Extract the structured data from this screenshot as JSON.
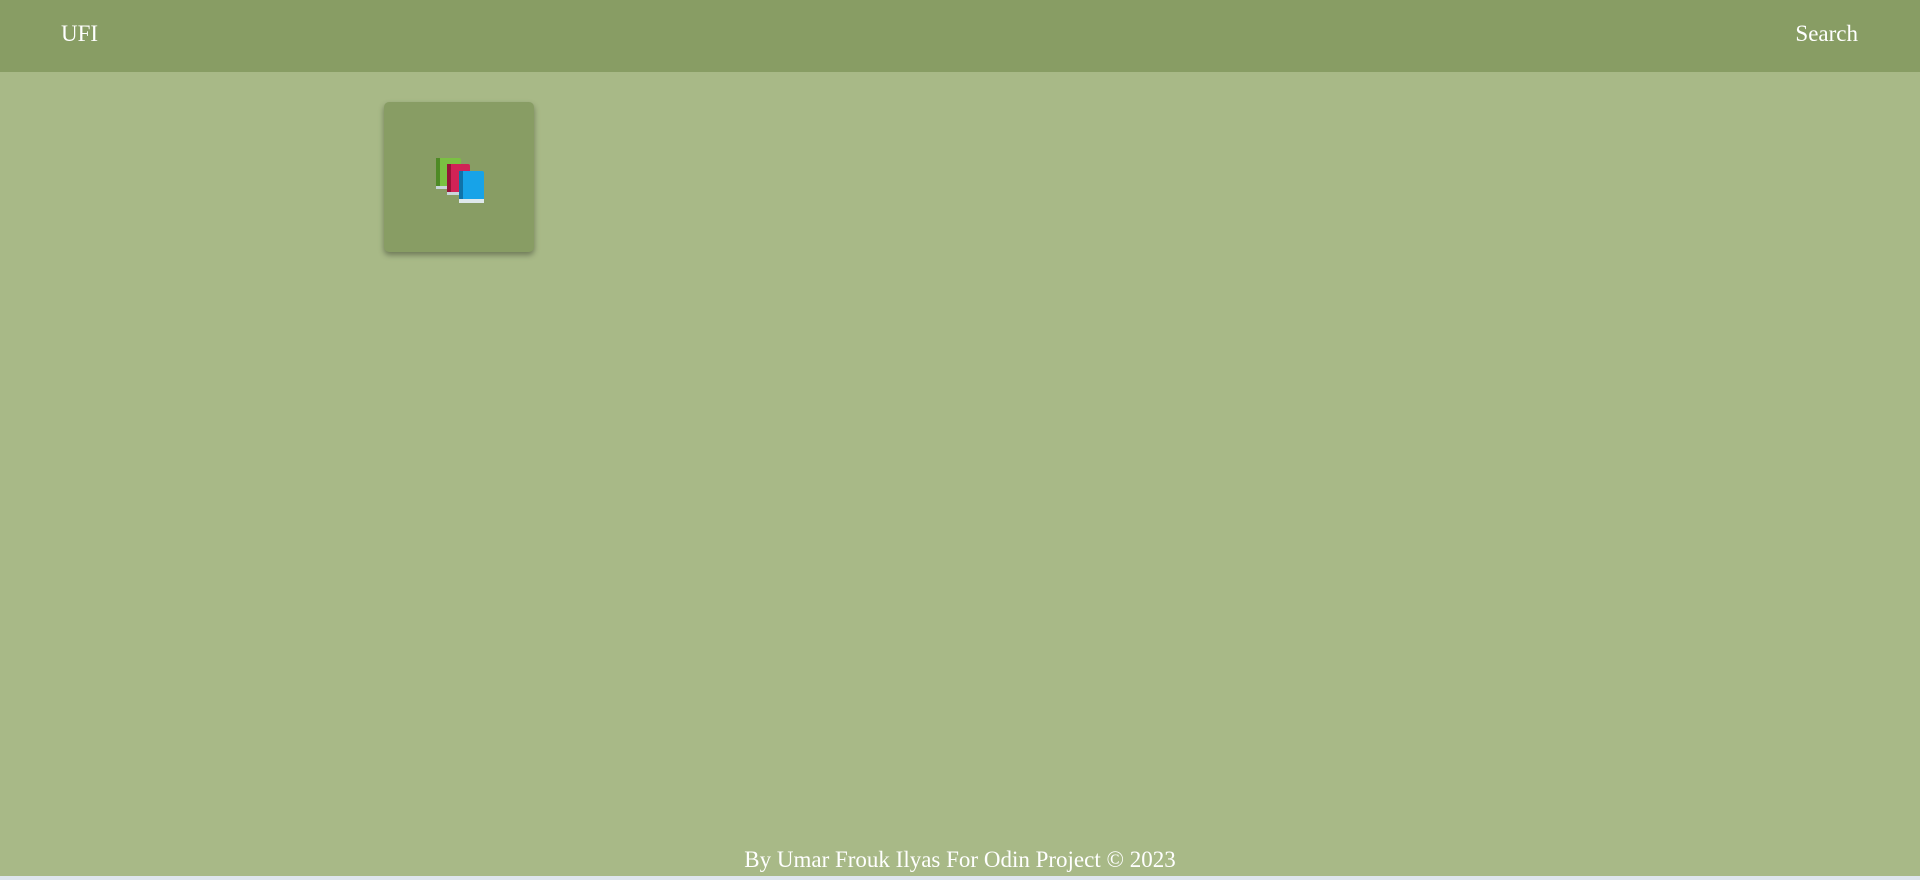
{
  "header": {
    "brand": "UFI",
    "search_label": "Search"
  },
  "card": {
    "icon": "books-icon"
  },
  "footer": {
    "text": "By Umar Frouk Ilyas For Odin Project © 2023"
  },
  "colors": {
    "page_background": "#a8b987",
    "header_background": "#889d64",
    "card_background": "#889d64",
    "text": "#ffffff"
  }
}
